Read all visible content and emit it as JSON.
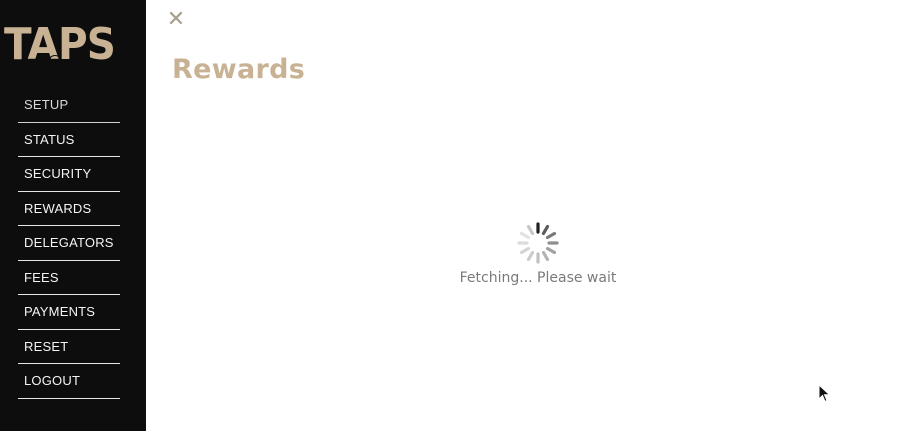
{
  "brand": {
    "logo_text": "TAPS"
  },
  "sidebar": {
    "items": [
      {
        "label": "SETUP",
        "active": true
      },
      {
        "label": "STATUS",
        "active": false
      },
      {
        "label": "SECURITY",
        "active": false
      },
      {
        "label": "REWARDS",
        "active": false
      },
      {
        "label": "DELEGATORS",
        "active": false
      },
      {
        "label": "FEES",
        "active": false
      },
      {
        "label": "PAYMENTS",
        "active": false
      },
      {
        "label": "RESET",
        "active": false
      },
      {
        "label": "LOGOUT",
        "active": false
      }
    ]
  },
  "main": {
    "close_icon": "close-icon",
    "title": "Rewards",
    "loading": {
      "icon": "spinner-icon",
      "text": "Fetching... Please wait"
    }
  },
  "colors": {
    "sidebar_bg": "#0d0d0d",
    "accent": "#c8b293",
    "loading_text": "#7a7a7a"
  }
}
